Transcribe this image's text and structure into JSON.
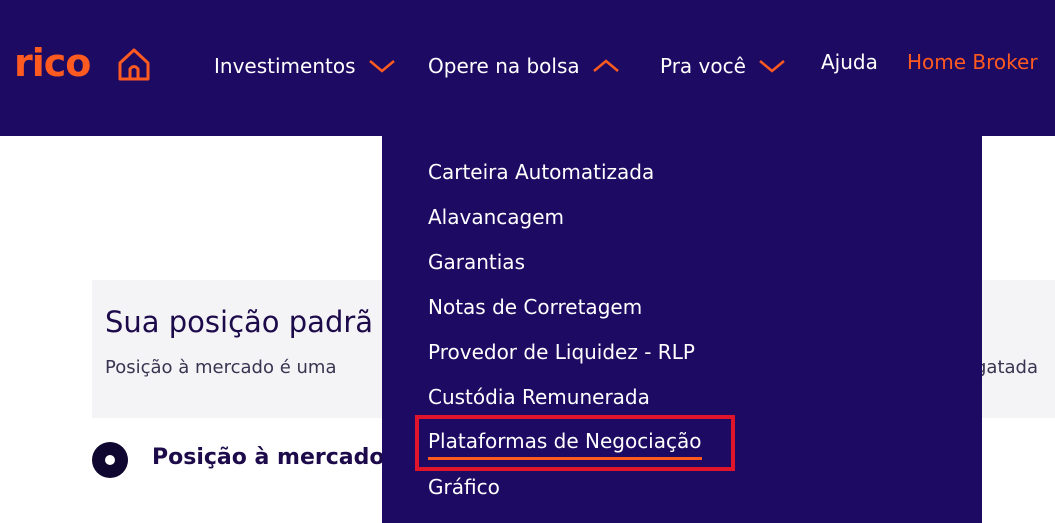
{
  "brand": {
    "logo_text": "rico",
    "accent": "#ff5a1f",
    "nav_bg": "#1d0b63"
  },
  "nav": {
    "items": [
      {
        "label": "Investimentos",
        "state": "collapsed"
      },
      {
        "label": "Opere na bolsa",
        "state": "expanded"
      },
      {
        "label": "Pra você",
        "state": "collapsed"
      },
      {
        "label": "Ajuda"
      },
      {
        "label": "Home Broker"
      }
    ]
  },
  "dropdown": {
    "items": [
      {
        "label": "Carteira Automatizada"
      },
      {
        "label": "Alavancagem"
      },
      {
        "label": "Garantias"
      },
      {
        "label": "Notas de Corretagem"
      },
      {
        "label": "Provedor de Liquidez - RLP"
      },
      {
        "label": "Custódia Remunerada"
      },
      {
        "label": "Plataformas de Negociação",
        "highlighted": true
      },
      {
        "label": "Gráfico"
      }
    ]
  },
  "content": {
    "title": "Sua posição padrã",
    "description": "Posição à mercado é uma",
    "description_right": "gatada",
    "option_label": "Posição à mercado"
  },
  "annotation": {
    "color": "#e0142a"
  }
}
